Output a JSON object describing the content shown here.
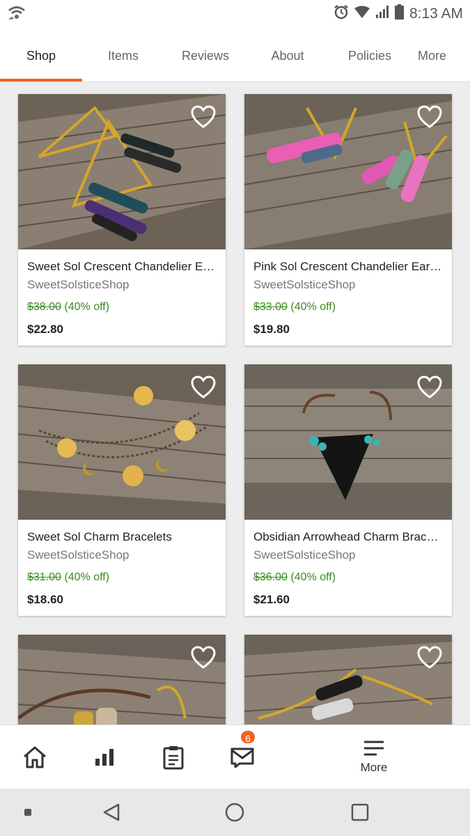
{
  "status": {
    "time": "8:13 AM"
  },
  "tabs": [
    {
      "label": "Shop"
    },
    {
      "label": "Items"
    },
    {
      "label": "Reviews"
    },
    {
      "label": "About"
    },
    {
      "label": "Policies"
    },
    {
      "label": "More"
    }
  ],
  "listings": [
    {
      "title": "Sweet Sol Crescent Chandelier Earrings",
      "shop": "SweetSolsticeShop",
      "original_price": "$38.00",
      "discount": "(40% off)",
      "price": "$22.80"
    },
    {
      "title": "Pink Sol Crescent Chandelier Earrings",
      "shop": "SweetSolsticeShop",
      "original_price": "$33.00",
      "discount": "(40% off)",
      "price": "$19.80"
    },
    {
      "title": "Sweet Sol Charm Bracelets",
      "shop": "SweetSolsticeShop",
      "original_price": "$31.00",
      "discount": "(40% off)",
      "price": "$18.60"
    },
    {
      "title": "Obsidian Arrowhead Charm Bracelet",
      "shop": "SweetSolsticeShop",
      "original_price": "$36.00",
      "discount": "(40% off)",
      "price": "$21.60"
    },
    {
      "title": "",
      "shop": "",
      "original_price": "",
      "discount": "",
      "price": ""
    },
    {
      "title": "",
      "shop": "",
      "original_price": "",
      "discount": "",
      "price": ""
    }
  ],
  "bottom_nav": {
    "messages_badge": "6",
    "more_label": "More"
  },
  "colors": {
    "accent": "#f1641e",
    "sale": "#3a8a1f"
  },
  "icons": [
    "wifi-call-icon",
    "alarm-icon",
    "wifi-icon",
    "signal-icon",
    "battery-icon",
    "heart-icon",
    "home-icon",
    "stats-icon",
    "orders-icon",
    "mail-icon",
    "menu-icon",
    "back-icon",
    "home-circle-icon",
    "recents-icon"
  ]
}
